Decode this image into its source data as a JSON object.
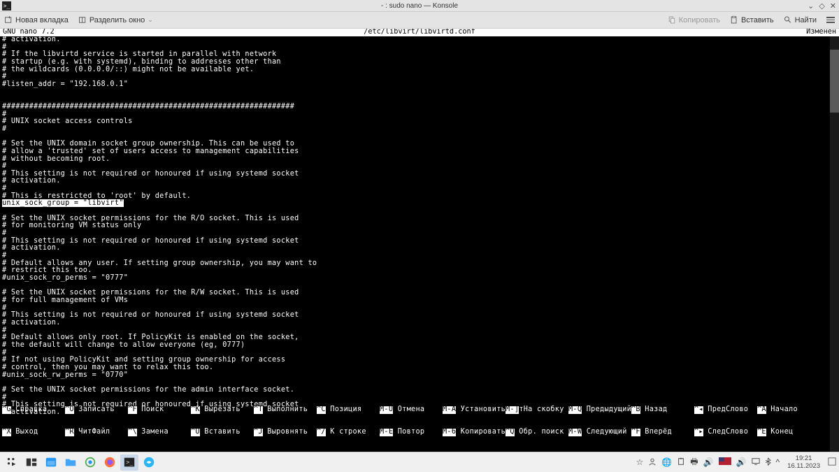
{
  "window": {
    "title": "- : sudo nano — Konsole",
    "controls": {
      "min": "⌄",
      "max": "◇",
      "close": "✕"
    }
  },
  "toolbar": {
    "new_tab": "Новая вкладка",
    "split": "Разделить окно",
    "copy": "Копировать",
    "paste": "Вставить",
    "find": "Найти"
  },
  "nano": {
    "app": "  GNU nano 7.2",
    "file": "/etc/libvirt/libvirtd.conf",
    "modified": "Изменён"
  },
  "editor_pre": "# activation.\n#\n# If the libvirtd service is started in parallel with network\n# startup (e.g. with systemd), binding to addresses other than\n# the wildcards (0.0.0.0/::) might not be available yet.\n#\n#listen_addr = \"192.168.0.1\"\n\n\n#################################################################\n#\n# UNIX socket access controls\n#\n\n# Set the UNIX domain socket group ownership. This can be used to\n# allow a 'trusted' set of users access to management capabilities\n# without becoming root.\n#\n# This setting is not required or honoured if using systemd socket\n# activation.\n#\n# This is restricted to 'root' by default.\n",
  "editor_highlight": "unix_sock_group = \"libvirt\"",
  "editor_post": "\n\n# Set the UNIX socket permissions for the R/O socket. This is used\n# for monitoring VM status only\n#\n# This setting is not required or honoured if using systemd socket\n# activation.\n#\n# Default allows any user. If setting group ownership, you may want to\n# restrict this too.\n#unix_sock_ro_perms = \"0777\"\n\n# Set the UNIX socket permissions for the R/W socket. This is used\n# for full management of VMs\n#\n# This setting is not required or honoured if using systemd socket\n# activation.\n#\n# Default allows only root. If PolicyKit is enabled on the socket,\n# the default will change to allow everyone (eg, 0777)\n#\n# If not using PolicyKit and setting group ownership for access\n# control, then you may want to relax this too.\n#unix_sock_rw_perms = \"0770\"\n\n# Set the UNIX socket permissions for the admin interface socket.\n#\n# This setting is not required or honoured if using systemd socket\n# activation.",
  "shortcuts": {
    "row1": [
      {
        "k": "^G",
        "l": "Справка"
      },
      {
        "k": "^O",
        "l": "Записать"
      },
      {
        "k": "^F",
        "l": "Поиск"
      },
      {
        "k": "^K",
        "l": "Вырезать"
      },
      {
        "k": "^T",
        "l": "Выполнить"
      },
      {
        "k": "^C",
        "l": "Позиция"
      },
      {
        "k": "M-U",
        "l": "Отмена"
      },
      {
        "k": "M-A",
        "l": "Установить мет"
      },
      {
        "k": "M-]",
        "l": "На скобку"
      },
      {
        "k": "M-Q",
        "l": "Предыдущий"
      },
      {
        "k": "^B",
        "l": "Назад"
      },
      {
        "k": "^◂",
        "l": "ПредСлово"
      },
      {
        "k": "^A",
        "l": "Начало"
      }
    ],
    "row2": [
      {
        "k": "^X",
        "l": "Выход"
      },
      {
        "k": "^R",
        "l": "ЧитФайл"
      },
      {
        "k": "^\\",
        "l": "Замена"
      },
      {
        "k": "^U",
        "l": "Вставить"
      },
      {
        "k": "^J",
        "l": "Выровнять"
      },
      {
        "k": "^/",
        "l": "К строке"
      },
      {
        "k": "M-E",
        "l": "Повтор"
      },
      {
        "k": "M-6",
        "l": "Копировать"
      },
      {
        "k": "^Q",
        "l": "Обр. поиск"
      },
      {
        "k": "M-W",
        "l": "Следующий"
      },
      {
        "k": "^F",
        "l": "Вперёд"
      },
      {
        "k": "^▸",
        "l": "СледСлово"
      },
      {
        "k": "^E",
        "l": "Конец"
      }
    ]
  },
  "taskbar": {
    "time": "19:21",
    "date": "16.11.2023",
    "lang": "EN"
  }
}
